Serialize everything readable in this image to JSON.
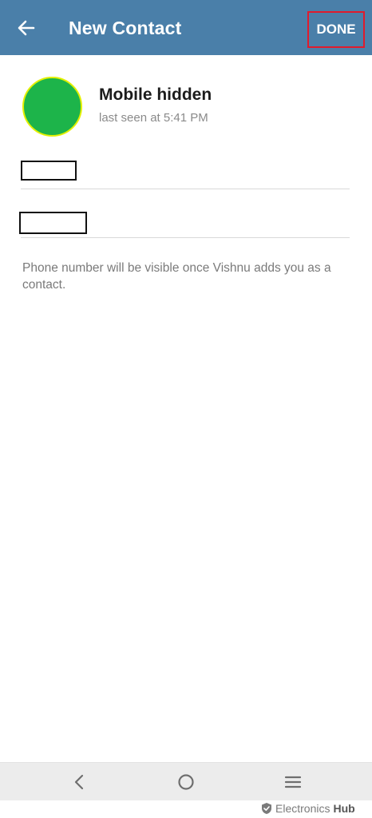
{
  "app_bar": {
    "title": "New Contact",
    "done_label": "DONE",
    "background_color": "#4a7fa9",
    "done_highlight_color": "#e01b2d",
    "back_icon": "arrow-left-icon"
  },
  "contact": {
    "name": "Mobile hidden",
    "status": "last seen at 5:41 PM",
    "avatar_color": "#1db44a",
    "avatar_border_color": "#e3f000"
  },
  "fields": {
    "first_name_value": "",
    "last_name_value": ""
  },
  "info": {
    "text": "Phone number will be visible once Vishnu adds you as a contact."
  },
  "nav_bar": {
    "back_icon": "chevron-left-icon",
    "home_icon": "circle-home-icon",
    "menu_icon": "menu-lines-icon"
  },
  "watermark": {
    "brand": "Electronics",
    "brand_bold": "Hub"
  }
}
